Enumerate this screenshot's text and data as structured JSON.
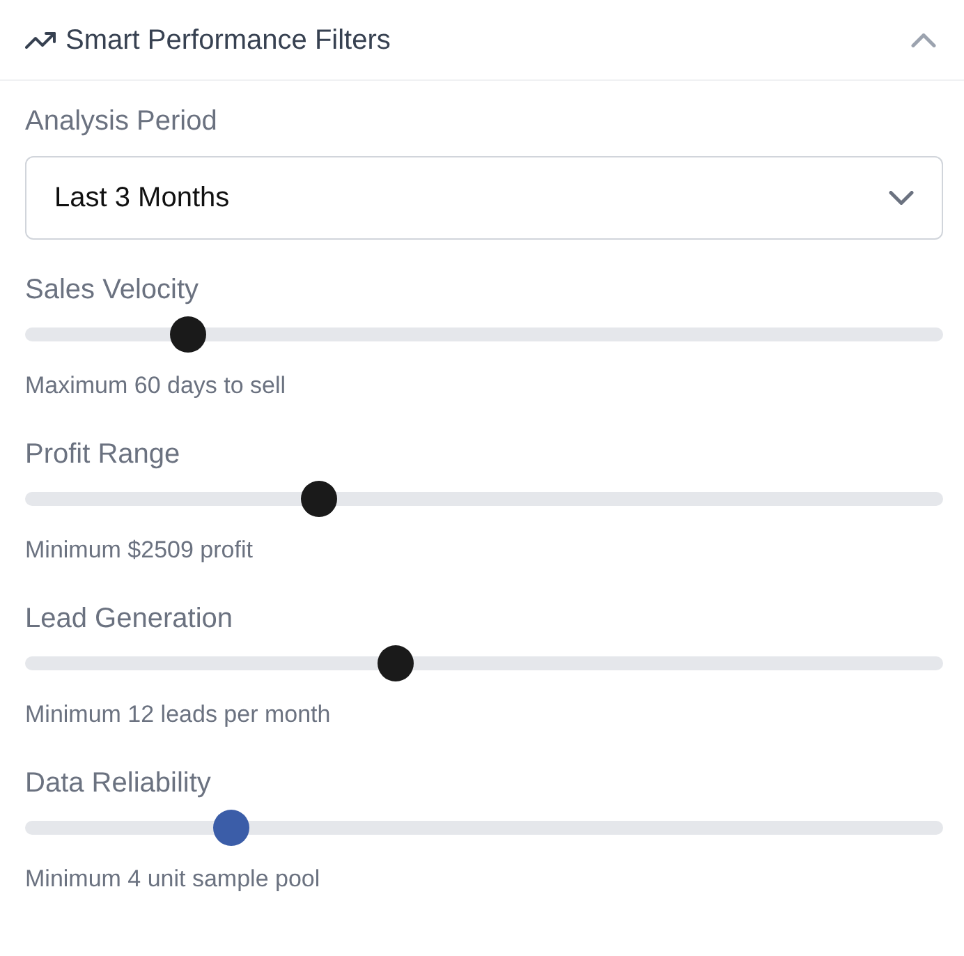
{
  "panel": {
    "title": "Smart Performance Filters",
    "expanded": true
  },
  "analysis_period": {
    "label": "Analysis Period",
    "value": "Last 3 Months"
  },
  "sliders": [
    {
      "label": "Sales Velocity",
      "level": 0.164,
      "focused": false,
      "hint": "Maximum 60 days to sell"
    },
    {
      "label": "Profit Range",
      "level": 0.313,
      "focused": false,
      "hint": "Minimum $2509 profit"
    },
    {
      "label": "Lead Generation",
      "level": 0.4,
      "focused": false,
      "hint": "Minimum 12 leads per month"
    },
    {
      "label": "Data Reliability",
      "level": 0.213,
      "focused": true,
      "hint": "Minimum 4 unit sample pool"
    }
  ]
}
